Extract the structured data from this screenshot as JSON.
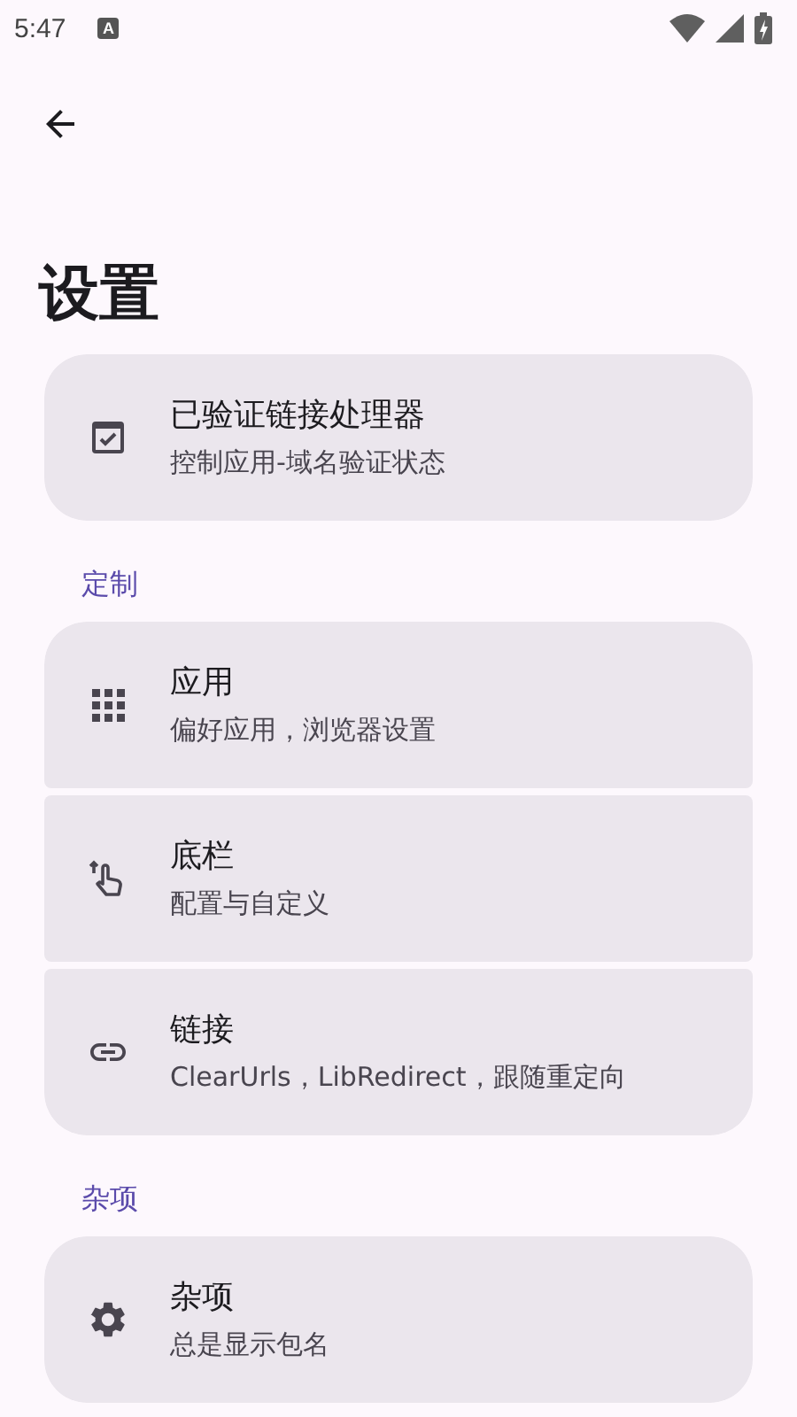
{
  "status_bar": {
    "time": "5:47",
    "notification": "A"
  },
  "title": "设置",
  "groups": [
    {
      "items": [
        {
          "title": "已验证链接处理器",
          "subtitle": "控制应用-域名验证状态"
        }
      ]
    },
    {
      "header": "定制",
      "items": [
        {
          "title": "应用",
          "subtitle": "偏好应用，浏览器设置"
        },
        {
          "title": "底栏",
          "subtitle": "配置与自定义"
        },
        {
          "title": "链接",
          "subtitle": "ClearUrls，LibRedirect，跟随重定向"
        }
      ]
    },
    {
      "header": "杂项",
      "items": [
        {
          "title": "杂项",
          "subtitle": "总是显示包名"
        }
      ]
    }
  ]
}
